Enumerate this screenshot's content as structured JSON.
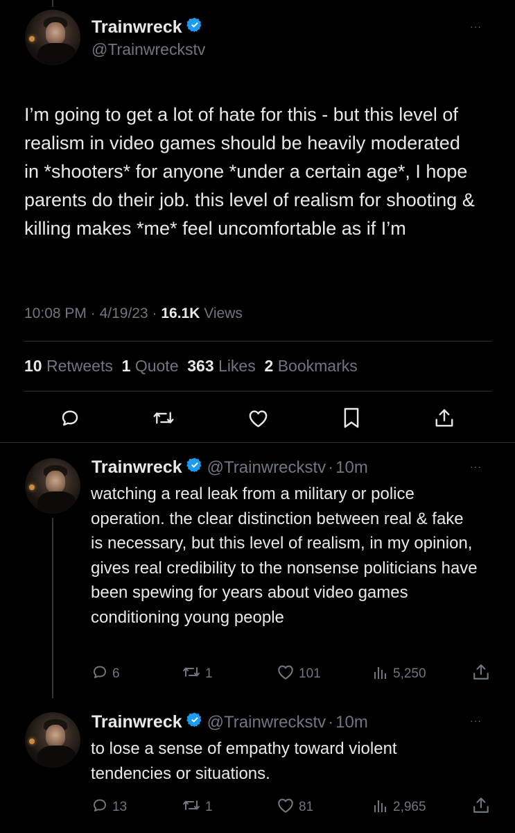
{
  "main_tweet": {
    "author_name": "Trainwreck",
    "handle": "@Trainwreckstv",
    "more": "···",
    "text": "I’m going to get a lot of hate for this - but this level of realism in video games should be heavily moderated in *shooters* for anyone *under a certain age*, I hope parents do their job. this level of realism for shooting & killing makes *me* feel uncomfortable as if I’m",
    "time": "10:08 PM",
    "sep1": "·",
    "date": "4/19/23",
    "sep2": "·",
    "views_count": "16.1K",
    "views_label": "Views",
    "stats": {
      "retweets_count": "10",
      "retweets_label": "Retweets",
      "quotes_count": "1",
      "quotes_label": "Quote",
      "likes_count": "363",
      "likes_label": "Likes",
      "bookmarks_count": "2",
      "bookmarks_label": "Bookmarks"
    }
  },
  "replies": [
    {
      "author_name": "Trainwreck",
      "handle": "@Trainwreckstv",
      "sep": "·",
      "time": "10m",
      "more": "···",
      "text": "watching a real leak from a military or police operation. the clear distinction between real & fake is necessary, but this level of realism, in my opinion, gives real credibility to the nonsense politicians have been spewing for years about video games conditioning young people",
      "replies": "6",
      "retweets": "1",
      "likes": "101",
      "views": "5,250"
    },
    {
      "author_name": "Trainwreck",
      "handle": "@Trainwreckstv",
      "sep": "·",
      "time": "10m",
      "more": "···",
      "text": "to lose a sense of empathy toward violent tendencies or situations.",
      "replies": "13",
      "retweets": "1",
      "likes": "81",
      "views": "2,965"
    }
  ],
  "colors": {
    "verified": "#1d9bf0",
    "text": "#e7e9ea",
    "muted": "#71767b",
    "divider": "#2f3336"
  }
}
